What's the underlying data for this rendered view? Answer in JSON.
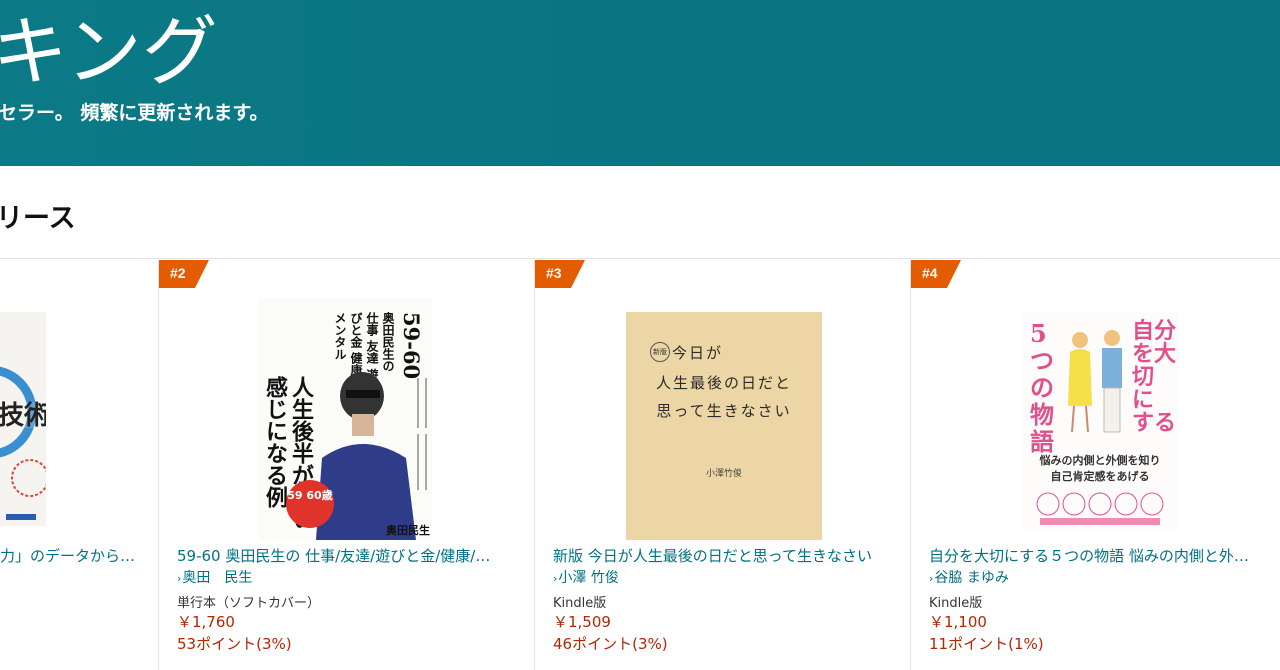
{
  "banner": {
    "title": "キング",
    "subtitle": "セラー。 頻繁に更新されます。"
  },
  "section": {
    "title": "リース"
  },
  "items": [
    {
      "title": "力」のデータから…"
    },
    {
      "rank": "#2",
      "cover": {
        "vertical_main": "人生後半がいい感じになる例",
        "vertical_sub": "奥田民生の 仕事 友達 遊びと金 健康 メンタル",
        "number": "59-60",
        "badge": "59 60歳",
        "author": "奥田民生"
      },
      "title": "59-60 奥田民生の 仕事/友達/遊びと金/健康/…",
      "author": "奥田　民生",
      "format": "単行本（ソフトカバー）",
      "price": "￥1,760",
      "points": "53ポイント(3%)"
    },
    {
      "rank": "#3",
      "cover": {
        "tag": "新版",
        "line1": "今日が",
        "line2": "人生最後の日だと",
        "line3": "思って生きなさい",
        "author": "小澤竹俊"
      },
      "title": "新版 今日が人生最後の日だと思って生きなさい",
      "author": "小澤 竹俊",
      "format": "Kindle版",
      "price": "￥1,509",
      "points": "46ポイント(3%)"
    },
    {
      "rank": "#4",
      "cover": {
        "left": "5つの物語",
        "right": "自分を大切にする",
        "sub1": "悩みの内側と外側を知り",
        "sub2": "自己肯定感をあげる"
      },
      "title": "自分を大切にする５つの物語 悩みの内側と外…",
      "author": "谷脇 まゆみ",
      "format": "Kindle版",
      "price": "￥1,100",
      "points": "11ポイント(1%)"
    }
  ],
  "colors": {
    "banner": "#0b7a86",
    "link": "#007185",
    "price": "#b12704",
    "rank_badge": "#e35d00"
  }
}
